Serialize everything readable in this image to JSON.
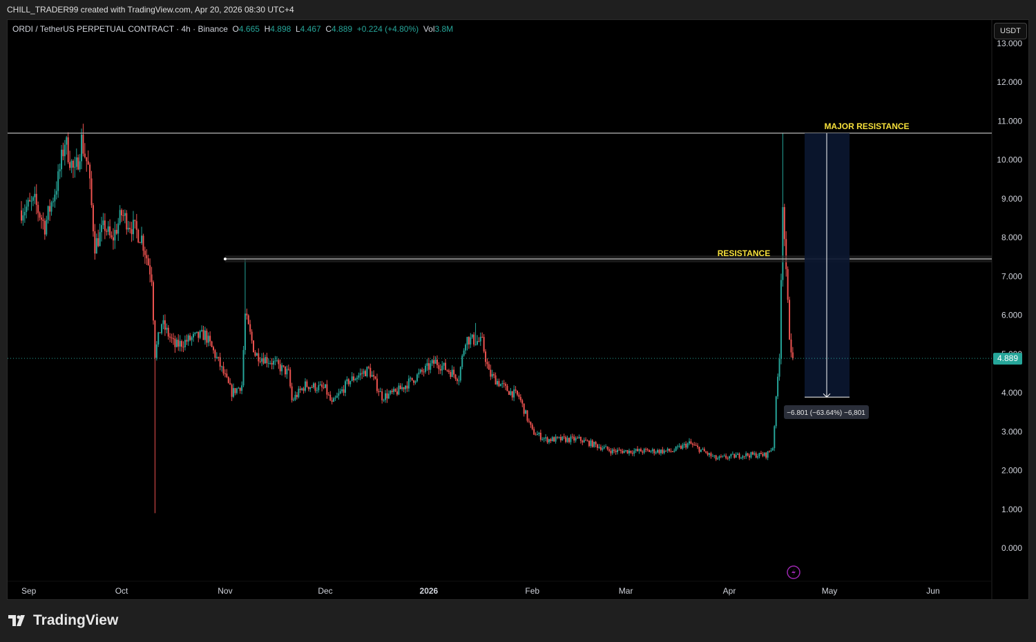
{
  "header": {
    "credit": "CHILL_TRADER99 created with TradingView.com, Apr 20, 2026 08:30 UTC+4"
  },
  "legend": {
    "symbol": "ORDI / TetherUS PERPETUAL CONTRACT · 4h · Binance",
    "o_label": "O",
    "o": "4.665",
    "h_label": "H",
    "h": "4.898",
    "l_label": "L",
    "l": "4.467",
    "c_label": "C",
    "c": "4.889",
    "change": "+0.224 (+4.80%)",
    "vol_label": "Vol",
    "vol": "3.8M"
  },
  "currency_button": "USDT",
  "footer": {
    "brand": "TradingView"
  },
  "colors": {
    "up": "#26a69a",
    "down": "#ef5350",
    "label": "#f7e13b",
    "box": "#0b1731"
  },
  "chart_data": {
    "type": "candlestick",
    "title": "ORDI / TetherUS PERPETUAL CONTRACT · 4h · Binance",
    "ylim": [
      0,
      13
    ],
    "y_ticks": [
      "0.000",
      "1.000",
      "2.000",
      "3.000",
      "4.000",
      "5.000",
      "6.000",
      "7.000",
      "8.000",
      "9.000",
      "10.000",
      "11.000",
      "12.000",
      "13.000"
    ],
    "x_ticks": [
      {
        "label": "Sep",
        "day": 0
      },
      {
        "label": "Oct",
        "day": 30
      },
      {
        "label": "Nov",
        "day": 61
      },
      {
        "label": "Dec",
        "day": 91
      },
      {
        "label": "2026",
        "day": 122
      },
      {
        "label": "Feb",
        "day": 153
      },
      {
        "label": "Mar",
        "day": 181
      },
      {
        "label": "Apr",
        "day": 212
      },
      {
        "label": "May",
        "day": 242
      },
      {
        "label": "Jun",
        "day": 273
      }
    ],
    "x_unit": "days since Sep 1, 2025",
    "price_path": [
      [
        0,
        8.7
      ],
      [
        4,
        8.9
      ],
      [
        7,
        8.3
      ],
      [
        11,
        9.5
      ],
      [
        13,
        10.5
      ],
      [
        16,
        9.6
      ],
      [
        18,
        10.5
      ],
      [
        20,
        9.8
      ],
      [
        22,
        7.8
      ],
      [
        25,
        8.3
      ],
      [
        27,
        7.9
      ],
      [
        30,
        8.6
      ],
      [
        36,
        8.0
      ],
      [
        39,
        7.0
      ],
      [
        40,
        5.0
      ],
      [
        42,
        5.8
      ],
      [
        46,
        5.2
      ],
      [
        51,
        5.4
      ],
      [
        55,
        5.5
      ],
      [
        59,
        4.8
      ],
      [
        63,
        4.0
      ],
      [
        66,
        4.2
      ],
      [
        67,
        6.0
      ],
      [
        70,
        5.0
      ],
      [
        75,
        4.8
      ],
      [
        80,
        4.5
      ],
      [
        81,
        3.8
      ],
      [
        85,
        4.2
      ],
      [
        91,
        4.1
      ],
      [
        93,
        3.7
      ],
      [
        98,
        4.3
      ],
      [
        104,
        4.6
      ],
      [
        108,
        3.9
      ],
      [
        112,
        4.0
      ],
      [
        118,
        4.4
      ],
      [
        124,
        4.8
      ],
      [
        131,
        4.4
      ],
      [
        133,
        5.4
      ],
      [
        138,
        5.3
      ],
      [
        140,
        4.5
      ],
      [
        145,
        4.1
      ],
      [
        149,
        3.9
      ],
      [
        153,
        3.0
      ],
      [
        157,
        2.8
      ],
      [
        167,
        2.8
      ],
      [
        177,
        2.5
      ],
      [
        185,
        2.5
      ],
      [
        195,
        2.5
      ],
      [
        200,
        2.7
      ],
      [
        208,
        2.3
      ],
      [
        216,
        2.4
      ],
      [
        223,
        2.4
      ],
      [
        225,
        2.6
      ],
      [
        227,
        5.0
      ],
      [
        228,
        9.0
      ],
      [
        229,
        7.0
      ],
      [
        230,
        5.5
      ],
      [
        231,
        4.889
      ]
    ],
    "wicks": [
      {
        "day": 40,
        "low": 0.9
      },
      {
        "day": 67,
        "high": 7.45
      },
      {
        "day": 136,
        "high": 5.8
      },
      {
        "day": 228,
        "high": 10.7
      }
    ],
    "last_price": "4.889",
    "annotations": [
      {
        "type": "hline",
        "label": "MAJOR RESISTANCE",
        "price": 10.69,
        "from_day": -5
      },
      {
        "type": "hline",
        "label": "RESISTANCE",
        "price": 7.45,
        "from_day": 61
      },
      {
        "type": "measure",
        "from_price": 10.69,
        "to_price": 3.89,
        "label": "−6.801 (−63.64%) −6,801"
      }
    ]
  }
}
